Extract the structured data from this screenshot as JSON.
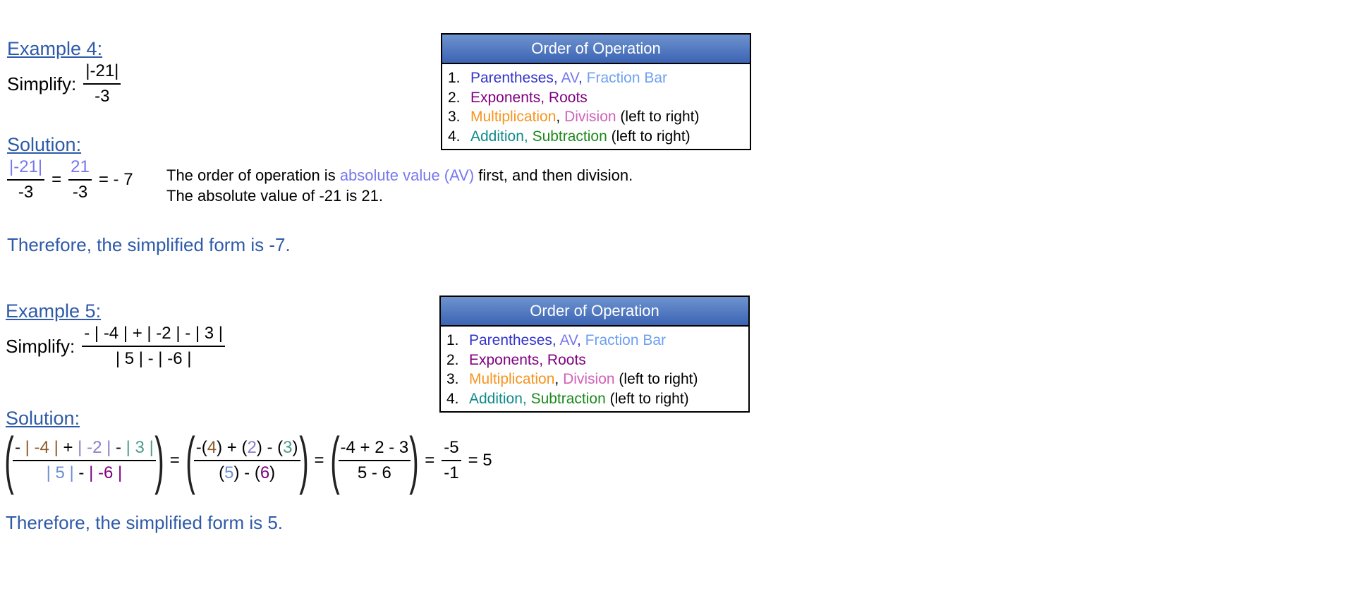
{
  "colors": {
    "heading_blue": "#2E5AA8",
    "parentheses": "#3333CC",
    "av": "#7777EE",
    "fraction_bar": "#6EA0F0",
    "exponents": "#800080",
    "multiplication": "#F7941D",
    "division": "#D060B8",
    "addition": "#0E8A8A",
    "subtraction": "#1A8A1A"
  },
  "order_of_operation": {
    "title": "Order of Operation",
    "items": [
      {
        "num": "1.",
        "parts": [
          {
            "text": "Parentheses",
            "color": "#3333CC"
          },
          {
            "text": ", ",
            "color": "#3333CC"
          },
          {
            "text": "AV",
            "color": "#7777EE"
          },
          {
            "text": ", ",
            "color": "#3333CC"
          },
          {
            "text": "Fraction Bar",
            "color": "#6EA0F0"
          }
        ]
      },
      {
        "num": "2.",
        "parts": [
          {
            "text": "Exponents",
            "color": "#800080"
          },
          {
            "text": ", ",
            "color": "#800080"
          },
          {
            "text": "Roots",
            "color": "#800080"
          }
        ]
      },
      {
        "num": "3.",
        "parts": [
          {
            "text": "Multiplication",
            "color": "#F7941D"
          },
          {
            "text": ", ",
            "color": "#000000"
          },
          {
            "text": "Division",
            "color": "#D060B8"
          },
          {
            "text": " (left to right)",
            "color": "#000000"
          }
        ]
      },
      {
        "num": "4.",
        "parts": [
          {
            "text": "Addition",
            "color": "#0E8A8A"
          },
          {
            "text": ", ",
            "color": "#0E8A8A"
          },
          {
            "text": "Subtraction",
            "color": "#1A8A1A"
          },
          {
            "text": " (left to right)",
            "color": "#000000"
          }
        ]
      }
    ]
  },
  "example4": {
    "heading": "Example 4:",
    "simplify_label": "Simplify:",
    "problem_num": "|-21|",
    "problem_den": "-3",
    "solution_heading": "Solution:",
    "step1_num": "|-21|",
    "step1_den": "-3",
    "eq1": "=",
    "step2_num": "21",
    "step2_den": "-3",
    "eq2": "= - 7",
    "explain1_a": "The order of operation is ",
    "explain1_b": "absolute value (AV)",
    "explain1_c": " first, and then division.",
    "explain2": "The absolute value of -21 is 21.",
    "conclusion": "Therefore, the simplified form is -7."
  },
  "example5": {
    "heading": "Example 5:",
    "simplify_label": "Simplify:",
    "problem_num": "- | -4 | + | -2 | - | 3 |",
    "problem_den": "| 5 | - | -6 |",
    "solution_heading": "Solution:",
    "s1_num_parts": [
      {
        "text": "- ",
        "color": "#000000"
      },
      {
        "text": "| -4 |",
        "color": "#8B5A2B"
      },
      {
        "text": " + ",
        "color": "#000000"
      },
      {
        "text": "| -2 |",
        "color": "#8A7FC8"
      },
      {
        "text": " - ",
        "color": "#000000"
      },
      {
        "text": "| 3 |",
        "color": "#4E9A8E"
      }
    ],
    "s1_den_parts": [
      {
        "text": "| 5 |",
        "color": "#6E8FD0"
      },
      {
        "text": " - ",
        "color": "#000000"
      },
      {
        "text": "| -6 |",
        "color": "#800080"
      }
    ],
    "s2_num_parts": [
      {
        "text": "-(",
        "color": "#000000"
      },
      {
        "text": "4",
        "color": "#8B5A2B"
      },
      {
        "text": ") + (",
        "color": "#000000"
      },
      {
        "text": "2",
        "color": "#8A7FC8"
      },
      {
        "text": ") - (",
        "color": "#000000"
      },
      {
        "text": "3",
        "color": "#4E9A8E"
      },
      {
        "text": ")",
        "color": "#000000"
      }
    ],
    "s2_den_parts": [
      {
        "text": "(",
        "color": "#000000"
      },
      {
        "text": "5",
        "color": "#6E8FD0"
      },
      {
        "text": ") - (",
        "color": "#000000"
      },
      {
        "text": "6",
        "color": "#800080"
      },
      {
        "text": ")",
        "color": "#000000"
      }
    ],
    "s3_num": "-4 + 2 - 3",
    "s3_den": "5 - 6",
    "s4_num": "-5",
    "s4_den": "-1",
    "eq": "=",
    "result": "= 5",
    "conclusion": "Therefore, the simplified form is 5."
  }
}
